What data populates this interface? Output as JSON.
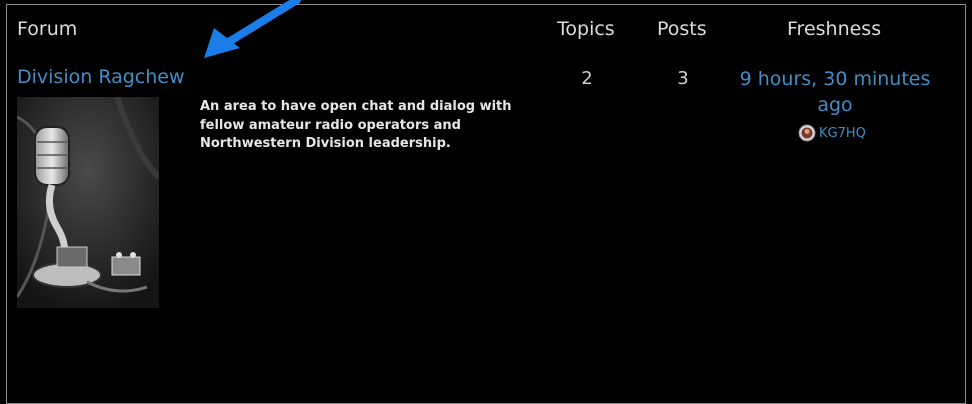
{
  "header": {
    "forum_label": "Forum",
    "topics_label": "Topics",
    "posts_label": "Posts",
    "freshness_label": "Freshness"
  },
  "forums": [
    {
      "title": "Division Ragchew",
      "description": "An area to have open chat and dialog with fellow amateur radio operators and Northwestern Division leadership.",
      "topics": "2",
      "posts": "3",
      "freshness": "9 hours, 30 minutes ago",
      "last_user": "KG7HQ"
    }
  ],
  "colors": {
    "link": "#3f8fc9",
    "annotation_arrow": "#1a7de8"
  },
  "icons": {
    "arrow": "annotation-arrow-icon",
    "avatar": "user-avatar-icon"
  }
}
